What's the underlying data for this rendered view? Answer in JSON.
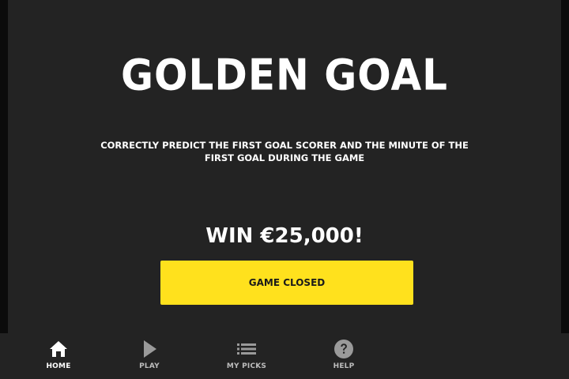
{
  "game": {
    "title": "GOLDEN GOAL",
    "description": "CORRECTLY PREDICT THE FIRST GOAL SCORER AND THE MINUTE OF THE FIRST GOAL DURING THE GAME",
    "prize": "WIN €25,000!",
    "cta_label": "GAME CLOSED",
    "cta_color": "#ffe11d"
  },
  "nav": {
    "items": [
      {
        "label": "HOME",
        "icon": "home-icon",
        "active": true
      },
      {
        "label": "PLAY",
        "icon": "play-icon",
        "active": false
      },
      {
        "label": "MY PICKS",
        "icon": "list-icon",
        "active": false
      },
      {
        "label": "HELP",
        "icon": "help-icon",
        "active": false
      }
    ]
  },
  "colors": {
    "background": "#232323",
    "accent": "#ffe11d",
    "text": "#ffffff",
    "inactive_icon": "#9a9a9a"
  }
}
